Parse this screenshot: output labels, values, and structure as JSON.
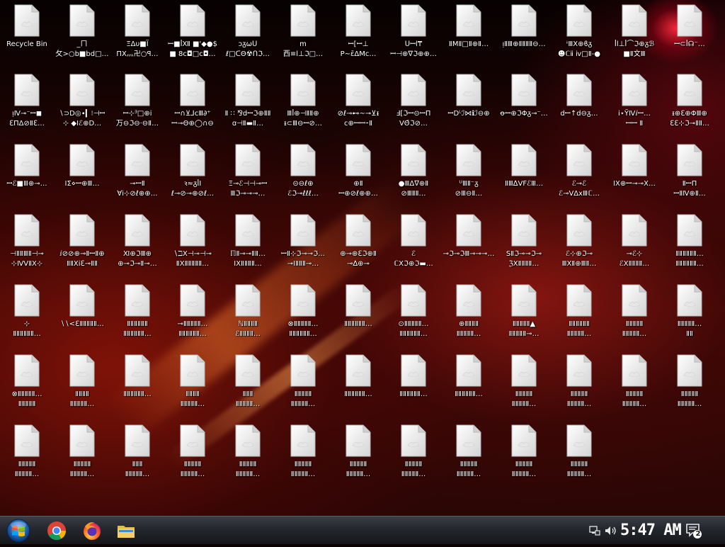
{
  "desktop": {
    "icons": [
      {
        "label": "Recycle Bin",
        "label2": "",
        "type": "recycle-bin"
      },
      {
        "label": "_ㄇ",
        "label2": "攵>○b■bd□…"
      },
      {
        "label": "ΞΔυ■Ϊ",
        "label2": "ΠΧ灬卍○ꟼ…"
      },
      {
        "label": "ꟷ■ꟾⅫ ■'◆●$",
        "label2": "■ 8ⅽ◘□ⅽ◘…"
      },
      {
        "label": "ɔᵹωᑌ",
        "label2": "ℓ□ᑕΘ☢ᑎℑ…"
      },
      {
        "label": "ⅿ",
        "label2": "西≡ⅼ⊥ℑ□…"
      },
      {
        "label": "ꟷ[ꟷ⊥",
        "label2": "P∼ε̄ΔⅯⅽ…"
      },
      {
        "label": "ᑌꟷⅼ₸",
        "label2": "ꟷ⊣⊕∇ℑ⊕⊕…"
      },
      {
        "label": "ⅡMⅡ□Ⅱ⊕Ⅱ…",
        "label2": ""
      },
      {
        "label": "ᴉⅡⅢ⊕ⅡⅡⅡⅡ⊖…",
        "label2": ""
      },
      {
        "label": "ᶤⅢΧ⊕ϐᵹ",
        "label2": "☻ℂⅱ ⅳ□Ⅱ-●"
      },
      {
        "label": "ꟾⅼ⊥ꟾ⌒ℑ⊕ᵹℬ",
        "label2": "■Ⅱ文Ⅲ"
      },
      {
        "label": "ꟷ⊂ꟾ☊⁻…",
        "label2": ""
      },
      {
        "label": "ᴉⅣ⊸⁻ꟷ◼",
        "label2": "ℇΠΔ⊘Ⅱℇ…"
      },
      {
        "label": "∖⊃Ⅾ◎∙▎⁝⊣ꟷ",
        "label2": "⊹ ◆Ⅰℰ⊕Ⅾ…"
      },
      {
        "label": "ꟷ⊹ᴲ□⊕ⅰ",
        "label2": "万⊖ℑ⊖⋅⊖Ⅱ…"
      },
      {
        "label": "ꟷ∩⊻⅃ⅽⅢ∂⁺",
        "label2": "ꟷ⊸Θ⊕◯∩⊖"
      },
      {
        "label": "Ⅱ ∷ ⅋ⅾꟷℑ⊕ⅡⅡ",
        "label2": "ꭤ⊣Ⅱ▬Ⅱ…"
      },
      {
        "label": "Ⅲꟾ⊕⊣ⅡⅡ⊕",
        "label2": "ᵻ⊂Ⅲ⊖ꟷ⊘…"
      },
      {
        "label": "⊘ℓ⊸⊷∼⊸⊻ᵻ",
        "label2": "ⅽ⊕ꟷꟷ⁃Ⅱ"
      },
      {
        "label": "Ⅎ[ℑꟷ⊝ꟷΠ",
        "label2": "VΘ̄ℑ⊘…"
      },
      {
        "label": "ꟷⅮᴸℐ⋈ℹℐ⊖⊕",
        "label2": ""
      },
      {
        "label": "ꝋꟷ⊕ℑΦᵹ⊸⁻…",
        "label2": ""
      },
      {
        "label": "ⅾꟷ↑ⅾ⊖ᵹ…",
        "label2": ""
      },
      {
        "label": "ⅰ⋆ΫⅣⅈꟷ…",
        "label2": "ꟷꟷ Ⅱ"
      },
      {
        "label": "ᵻ⊕ℇ⊕ΦⅢ⊕",
        "label2": "ℇℇ⊹ℑ⊸ⅡⅡ…"
      },
      {
        "label": "ꟷℰ■Ⅲ⊕⊸…",
        "label2": ""
      },
      {
        "label": "ⅠΣ⋄ꟷ⊕Ⅲ…",
        "label2": ""
      },
      {
        "label": "⊸ꟷⅡ",
        "label2": "∀ⅰ⊹⊘ℓ⊕⊕…"
      },
      {
        "label": "ꝛ≈ᵹꟾΙ",
        "label2": "ℓ⊸⊘⊸⊕⊘ℓ…"
      },
      {
        "label": "Ξ⊸ℰ⊣⊣⊸ꟷ",
        "label2": "Ⅲℑ⊸⊸⊸…"
      },
      {
        "label": "⊝⊖ℓ⊕",
        "label2": "ℰℑ⊸ℓℓℓ…"
      },
      {
        "label": "⊕Ⅱ",
        "label2": "ꟷ⊕⊘ℓ⊕⊕…"
      },
      {
        "label": "●ⅢΔ∇⊕Ⅱ",
        "label2": "⊘ⅢⅡⅡ…"
      },
      {
        "label": "ᵁⅢⅡ⁻ᵹ",
        "label2": "⊘Ⅲ⊖Ⅱ…"
      },
      {
        "label": "ⅡⅢ∆VFℰⅢ…",
        "label2": ""
      },
      {
        "label": "ℰ⊸ℰ",
        "label2": "ℰ⊸VΔⅹⅢℂ…"
      },
      {
        "label": "ⅠⅩ⊕ꟷ⊸⊸Ⅹ…",
        "label2": ""
      },
      {
        "label": "ⅡꟷΠ",
        "label2": "ꟷⅡⅣ⊕Ⅱ…"
      },
      {
        "label": "⊣ⅡⅡⅢⅡ⊣⊸",
        "label2": "⊹ⅣⅤⅡⅩ⊹"
      },
      {
        "label": "ⅈ⊘⊘⊕⊸ⅡꟷⅡ⊕",
        "label2": "ⅡⅡⅩⅰℇ⊸ⅡⅡ"
      },
      {
        "label": "Ⅺ⊕ℑⅢ⊕",
        "label2": "⊕⊸ℑ⊸Ⅱ⊸…"
      },
      {
        "label": "∖ℶⅩ⊣⊸⊣⊸",
        "label2": "ⅡⅩⅡⅡⅡⅡⅡ…"
      },
      {
        "label": "ℿⅡ⊸⊸ⅡⅡ…",
        "label2": "ⅠⅩⅡⅡⅡⅡ…"
      },
      {
        "label": "ꟷⅡ⊹ℑ⊸⊸ℑ…",
        "label2": "⊸ⅠⅡⅡⅡ⊸…"
      },
      {
        "label": "⊕⊸⊕ℇℑ⊕Ⅱ",
        "label2": "⊸∆⊕⊸"
      },
      {
        "label": "ℰ",
        "label2": "ℂⅩℑ⊕ℑ▬…"
      },
      {
        "label": "⊸ℑ⊸ℑⅢ⊸⊸⊸…",
        "label2": ""
      },
      {
        "label": "SⅡℑ⊸⊸ℑ⊸",
        "label2": "ℨⅩⅡⅡⅡⅡ…"
      },
      {
        "label": "ℰ⊹⊕ℑ⊸",
        "label2": "ⅢⅩⅡ⊕ⅢⅡ…"
      },
      {
        "label": "⊸ℰ⊹",
        "label2": "ℰⅩⅡⅡⅡⅡ…"
      },
      {
        "label": "ⅡⅡⅡⅡⅡⅡ…",
        "label2": "ⅡⅡⅡⅡⅡⅡ…"
      },
      {
        "label": "⊹",
        "label2": "ⅡⅡⅡⅡⅡⅡ…"
      },
      {
        "label": "∖∖<ℇⅡⅡⅡⅡⅡ…",
        "label2": ""
      },
      {
        "label": "ⅡⅡⅡⅡⅡⅡ",
        "label2": "ⅡⅡⅡⅡⅡⅡ…"
      },
      {
        "label": "⊸ⅡⅡⅡⅡⅡ…",
        "label2": "ⅡⅡⅡⅡⅡⅡ…"
      },
      {
        "label": "ℕⅡⅡⅡⅡ",
        "label2": "ℰⅡⅡⅡⅡ…"
      },
      {
        "label": "⊗ⅡⅡⅡⅡⅡ…",
        "label2": "ⅡⅡⅡⅡⅡⅡ…"
      },
      {
        "label": "ⅡⅡⅡⅡⅡⅡ…",
        "label2": ""
      },
      {
        "label": "⊙ⅡⅡⅡⅡⅡ…",
        "label2": "ⅡⅡⅡⅡⅡⅡ…"
      },
      {
        "label": "⊕ⅡⅡⅡⅡ",
        "label2": "ⅡⅡⅡⅡⅡ…"
      },
      {
        "label": "ⅡⅡⅡⅡⅡ▲",
        "label2": "ⅡⅡⅡⅡⅡ⊸…"
      },
      {
        "label": "ⅡⅡⅡⅡⅡⅡ",
        "label2": "ⅡⅡⅡⅡⅡ…"
      },
      {
        "label": "ⅡⅡⅡⅡⅡ",
        "label2": "ⅡⅡⅡⅡⅡ…"
      },
      {
        "label": "ⅡⅡⅡⅡⅡ…",
        "label2": "ⅡⅡ"
      },
      {
        "label": "⊗ⅡⅡⅡⅡⅡ…",
        "label2": "ⅡⅡⅡⅡⅡ"
      },
      {
        "label": "ⅡⅡⅡⅡ",
        "label2": "ⅡⅡⅡⅡⅡ…"
      },
      {
        "label": "ⅡⅡⅡⅡⅡⅡ…",
        "label2": ""
      },
      {
        "label": "ⅡⅡⅡⅡ",
        "label2": "ⅡⅡⅡⅡⅡ…"
      },
      {
        "label": "ⅡⅡⅡ",
        "label2": "ⅡⅡⅡⅡⅡ…"
      },
      {
        "label": "ⅡⅡⅡⅡⅡ",
        "label2": "ⅡⅡⅡⅡⅡ…"
      },
      {
        "label": "ⅡⅡⅡⅡⅡⅡ…",
        "label2": ""
      },
      {
        "label": "ⅡⅡⅡⅡⅡⅡ…",
        "label2": ""
      },
      {
        "label": "ⅡⅡⅡⅡⅡⅡ…",
        "label2": ""
      },
      {
        "label": "ⅡⅡⅡⅡⅡ",
        "label2": "ⅡⅡⅡⅡⅡ…"
      },
      {
        "label": "ⅡⅡⅡⅡⅡ",
        "label2": "ⅡⅡⅡⅡⅡ…"
      },
      {
        "label": "ⅡⅡⅡⅡⅡ",
        "label2": "ⅡⅡⅡⅡⅡ…"
      },
      {
        "label": "ⅡⅡⅡⅡⅡ",
        "label2": "ⅡⅡⅡⅡⅡ…"
      },
      {
        "label": "ⅡⅡⅡⅡⅡ",
        "label2": "ⅡⅡⅡⅡⅡ…"
      },
      {
        "label": "ⅡⅡⅡⅡⅡ",
        "label2": "ⅡⅡⅡⅡⅡ…"
      },
      {
        "label": "ⅡⅡⅡ",
        "label2": "ⅡⅡⅡⅡⅡ…"
      },
      {
        "label": "ⅡⅡⅡⅡⅡ",
        "label2": "ⅡⅡⅡⅡⅡ…"
      },
      {
        "label": "ⅡⅡⅡⅡⅡ",
        "label2": "ⅡⅡⅡⅡⅡ…"
      },
      {
        "label": "ⅡⅡⅡⅡⅡ",
        "label2": "ⅡⅡⅡⅡⅡ…"
      },
      {
        "label": "ⅡⅡⅡⅡⅡ",
        "label2": "ⅡⅡⅡⅡⅡ…"
      },
      {
        "label": "ⅡⅡⅡⅡⅡ",
        "label2": "ⅡⅡⅡⅡⅡ…"
      },
      {
        "label": "ⅡⅡⅡⅡⅡ",
        "label2": "ⅡⅡⅡⅡⅡ…"
      },
      {
        "label": "ⅡⅡⅡⅡⅡ",
        "label2": "ⅡⅡⅡⅡⅡ…"
      },
      {
        "label": "ⅡⅡⅡⅡⅡ",
        "label2": "ⅡⅡⅡⅡⅡ…"
      }
    ]
  },
  "taskbar": {
    "start_label": "Start",
    "pinned": [
      {
        "name": "chrome-icon",
        "title": "Google Chrome"
      },
      {
        "name": "firefox-icon",
        "title": "Mozilla Firefox"
      },
      {
        "name": "folder-icon",
        "title": "File Explorer"
      }
    ],
    "tray": {
      "clock": "5:47 AM",
      "notification_count": "2",
      "network_icon": "network-icon",
      "volume_icon": "volume-icon"
    }
  },
  "colors": {
    "taskbar_top": "#3a3e45",
    "taskbar_bottom": "#15171b",
    "label_text": "#ffffff",
    "file_icon": "#e8e8e8"
  }
}
